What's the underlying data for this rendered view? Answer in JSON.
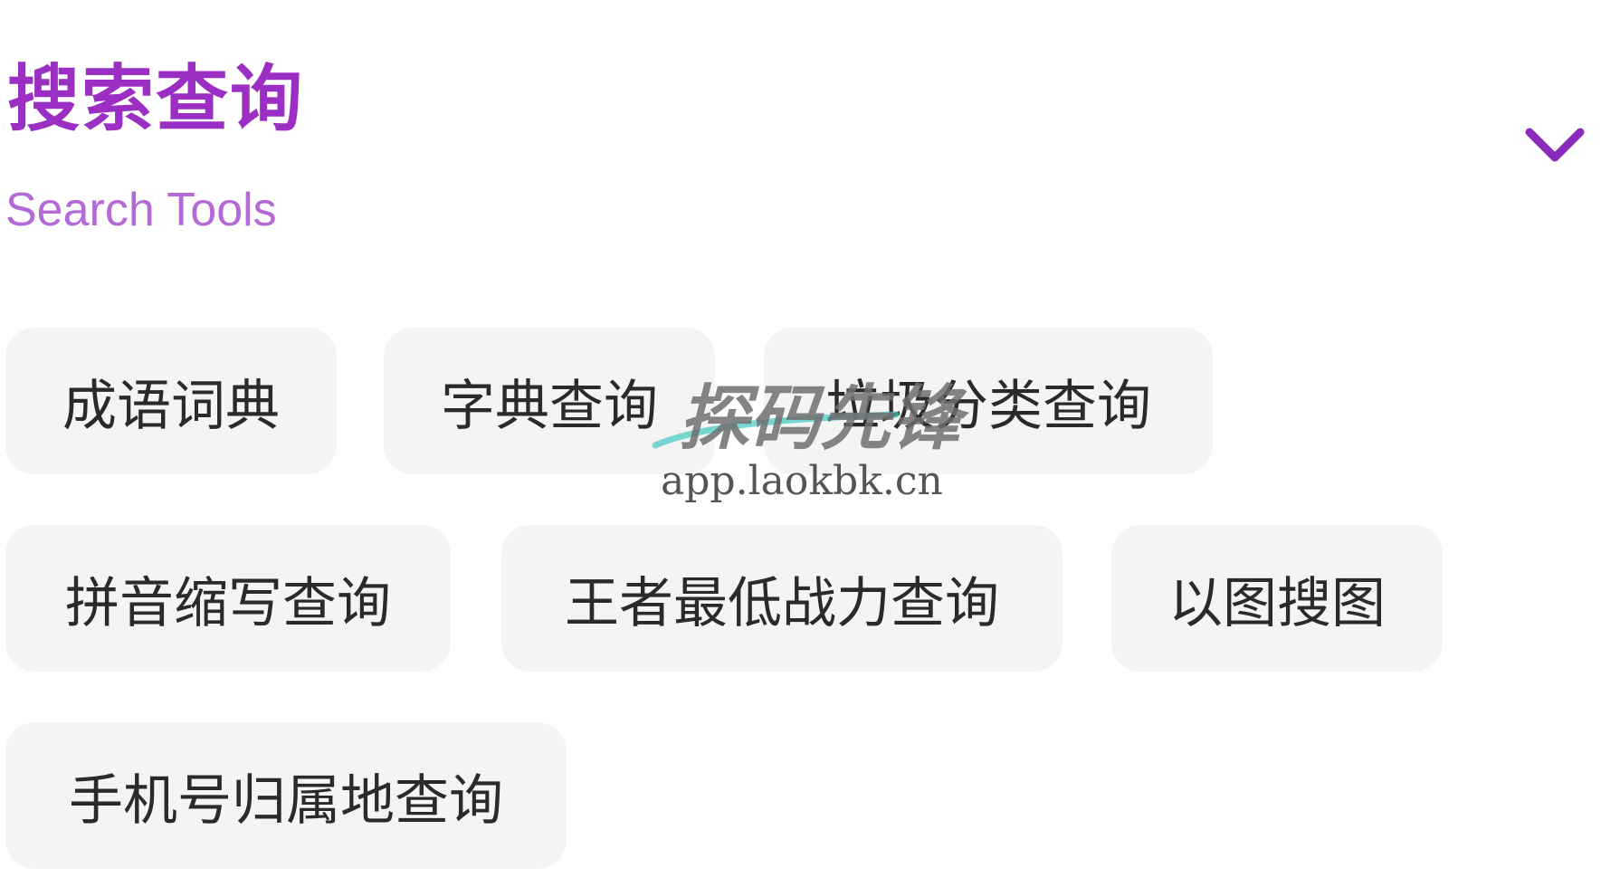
{
  "section": {
    "title": "搜索查询",
    "subtitle": "Search Tools",
    "accent_color": "#9b2fc4",
    "subtitle_color": "#b46ad6",
    "collapse_icon": "chevron-down-icon"
  },
  "tools": [
    {
      "label": "成语词典"
    },
    {
      "label": "字典查询"
    },
    {
      "label": "垃圾分类查询"
    },
    {
      "label": "拼音缩写查询"
    },
    {
      "label": "王者最低战力查询"
    },
    {
      "label": "以图搜图"
    },
    {
      "label": "手机号归属地查询"
    }
  ],
  "watermark": {
    "brand": "探码先锋",
    "url": "app.laokbk.cn"
  }
}
